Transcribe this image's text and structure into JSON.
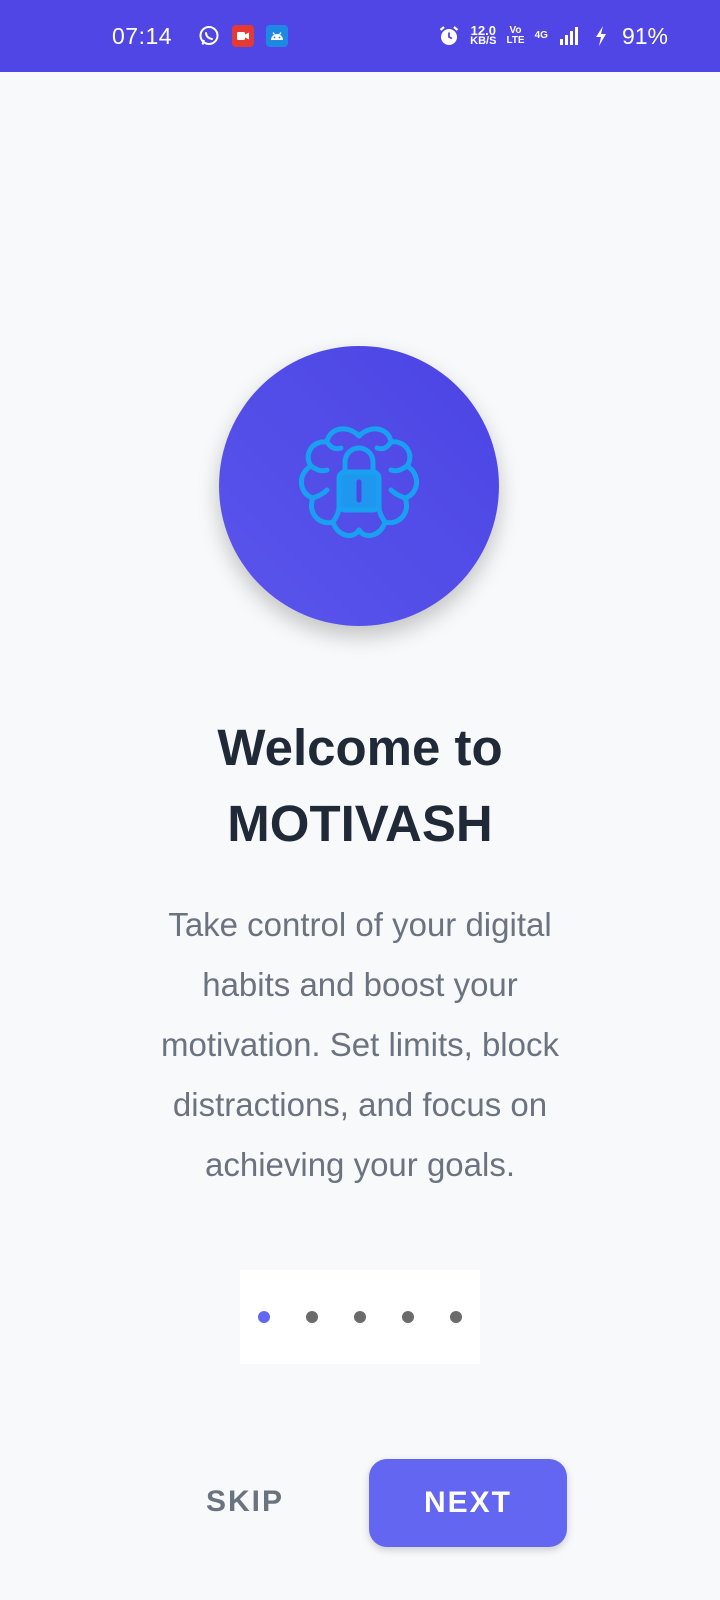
{
  "status_bar": {
    "time": "07:14",
    "net_speed_value": "12.0",
    "net_speed_unit": "KB/S",
    "volte_top": "Vo",
    "volte_bottom": "LTE",
    "network": "4G",
    "battery": "91%",
    "background_color": "#4f46e5",
    "notification_icons": [
      "whatsapp-icon",
      "screen-recorder-icon",
      "android-icon"
    ],
    "system_icons": [
      "alarm-icon",
      "signal-icon",
      "charging-icon"
    ]
  },
  "onboarding": {
    "hero_icon": "brain-lock-icon",
    "title_line1": "Welcome to",
    "title_line2": "MOTIVASH",
    "description": "Take control of your digital habits and boost your motivation. Set limits, block distractions, and focus on achieving your goals.",
    "page_count": 5,
    "active_page": 1
  },
  "actions": {
    "skip_label": "SKIP",
    "next_label": "NEXT"
  },
  "colors": {
    "accent": "#6366f1",
    "hero_circle": "#4f46e5",
    "title": "#1f2937",
    "body_text": "#6b7280",
    "background": "#f8f9fa"
  }
}
